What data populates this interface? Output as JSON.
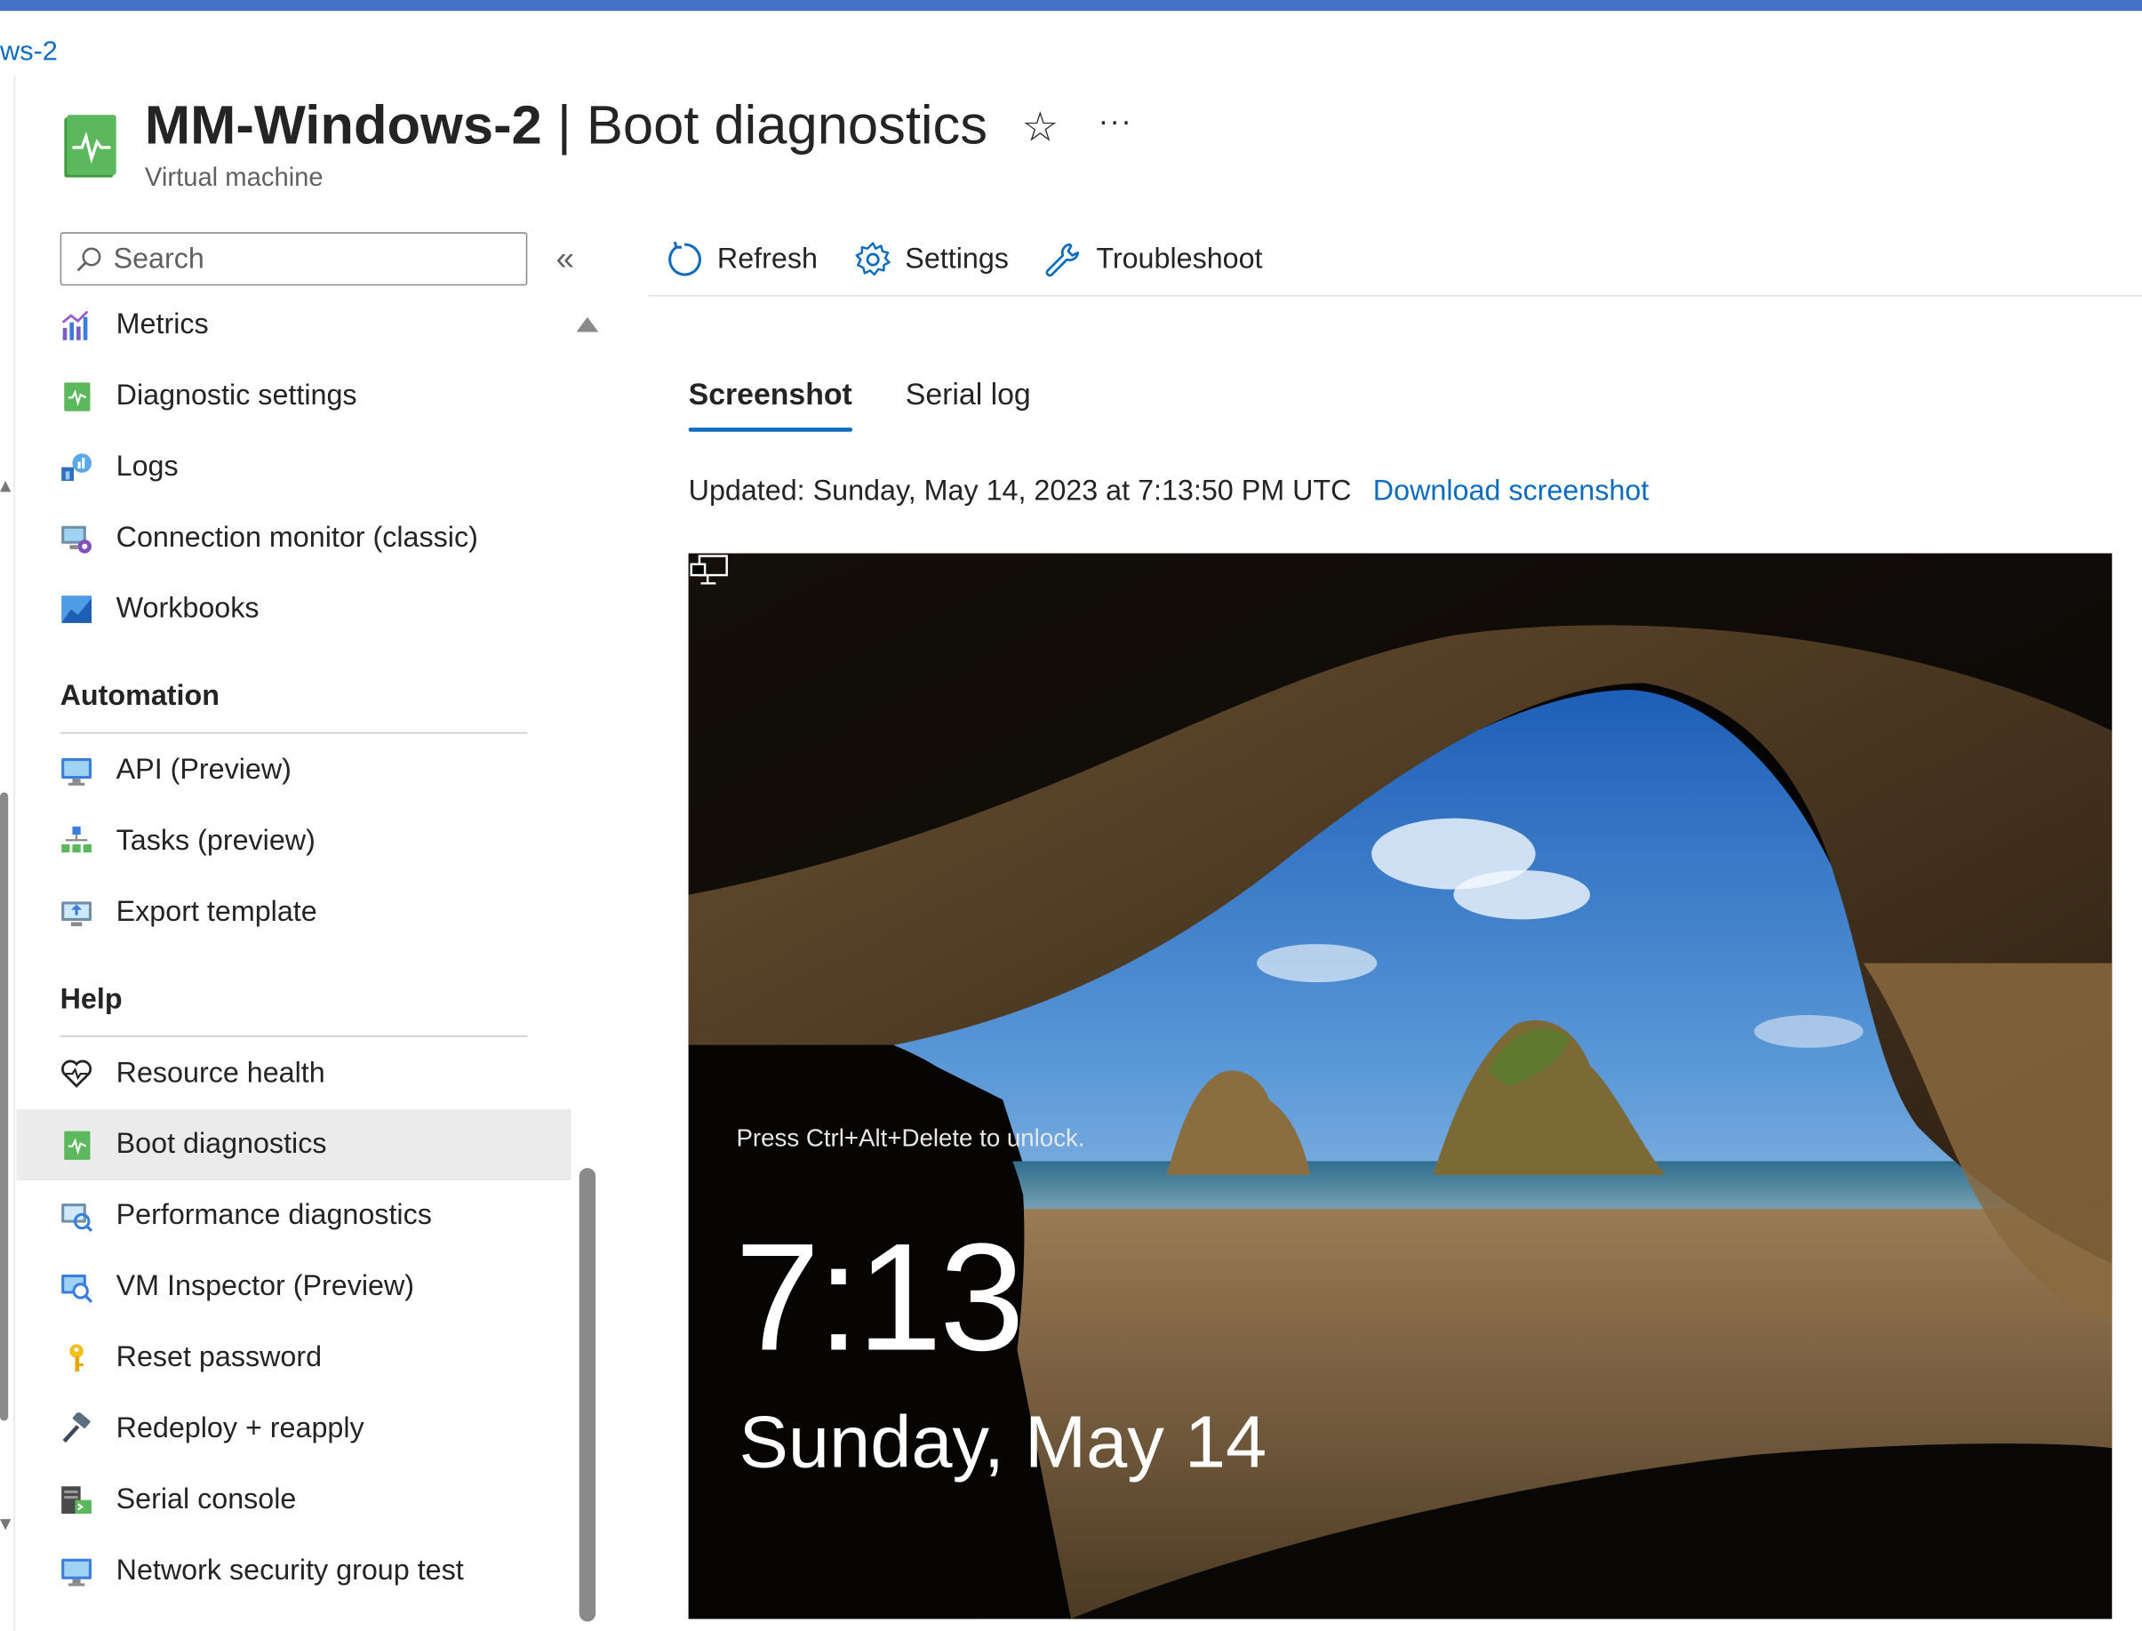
{
  "breadcrumb": {
    "text": "ws-2"
  },
  "header": {
    "resource_name": "MM-Windows-2",
    "separator": "|",
    "page_name": "Boot diagnostics",
    "resource_type": "Virtual machine",
    "favorite_glyph": "☆",
    "more_glyph": "···"
  },
  "sidebar": {
    "search_placeholder": "Search",
    "collapse_glyph": "«",
    "items_top": [
      {
        "label": "Metrics",
        "icon": "metrics-icon"
      },
      {
        "label": "Diagnostic settings",
        "icon": "diagnostic-settings-icon"
      },
      {
        "label": "Logs",
        "icon": "logs-icon"
      },
      {
        "label": "Connection monitor (classic)",
        "icon": "connection-monitor-icon"
      },
      {
        "label": "Workbooks",
        "icon": "workbooks-icon"
      }
    ],
    "automation": {
      "heading": "Automation",
      "items": [
        {
          "label": "API (Preview)",
          "icon": "api-icon"
        },
        {
          "label": "Tasks (preview)",
          "icon": "tasks-icon"
        },
        {
          "label": "Export template",
          "icon": "export-template-icon"
        }
      ]
    },
    "help": {
      "heading": "Help",
      "items": [
        {
          "label": "Resource health",
          "icon": "heart-icon"
        },
        {
          "label": "Boot diagnostics",
          "icon": "boot-diagnostics-icon",
          "active": true
        },
        {
          "label": "Performance diagnostics",
          "icon": "performance-diagnostics-icon"
        },
        {
          "label": "VM Inspector (Preview)",
          "icon": "vm-inspector-icon"
        },
        {
          "label": "Reset password",
          "icon": "key-icon"
        },
        {
          "label": "Redeploy + reapply",
          "icon": "hammer-icon"
        },
        {
          "label": "Serial console",
          "icon": "serial-console-icon"
        },
        {
          "label": "Network security group test",
          "icon": "nsg-test-icon"
        }
      ]
    }
  },
  "toolbar": {
    "refresh_label": "Refresh",
    "settings_label": "Settings",
    "troubleshoot_label": "Troubleshoot"
  },
  "tabs": [
    {
      "label": "Screenshot",
      "active": true
    },
    {
      "label": "Serial log",
      "active": false
    }
  ],
  "status": {
    "updated_text": "Updated: Sunday, May 14, 2023 at 7:13:50 PM UTC",
    "download_link": "Download screenshot"
  },
  "lock_screen": {
    "prompt": "Press Ctrl+Alt+Delete to unlock.",
    "time": "7:13",
    "date": "Sunday, May 14",
    "network_icon": "network-icon"
  },
  "colors": {
    "accent": "#0f6cbd",
    "topbar": "#4472c4",
    "active_row": "#ebebeb",
    "vm_icon_green": "#5cb85c"
  }
}
